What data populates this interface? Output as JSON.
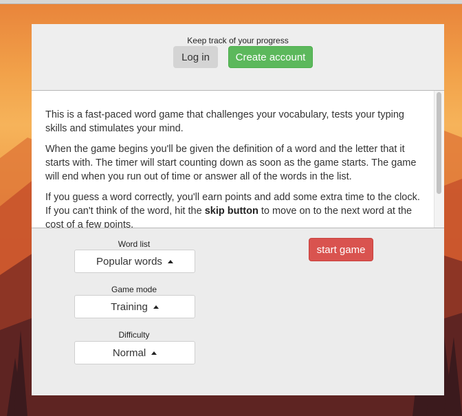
{
  "header": {
    "track_label": "Keep track of your progress",
    "login_label": "Log in",
    "create_account_label": "Create account"
  },
  "intro": {
    "paragraph1": "This is a fast-paced word game that challenges your vocabulary, tests your typing skills and stimulates your mind.",
    "paragraph2": "When the game begins you'll be given the definition of a word and the letter that it starts with. The timer will start counting down as soon as the game starts. The game will end when you run out of time or answer all of the words in the list.",
    "paragraph3_before": "If you guess a word correctly, you'll earn points and add some extra time to the clock. If you can't think of the word, hit the ",
    "paragraph3_bold": "skip button",
    "paragraph3_after": " to move on to the next word at the cost of a few points."
  },
  "settings": {
    "word_list_label": "Word list",
    "word_list_value": "Popular words",
    "game_mode_label": "Game mode",
    "game_mode_value": "Training",
    "difficulty_label": "Difficulty",
    "difficulty_value": "Normal"
  },
  "actions": {
    "start_label": "start game"
  },
  "colors": {
    "create_account": "#5cb85c",
    "start_game": "#d9534f",
    "login": "#d4d4d4"
  }
}
